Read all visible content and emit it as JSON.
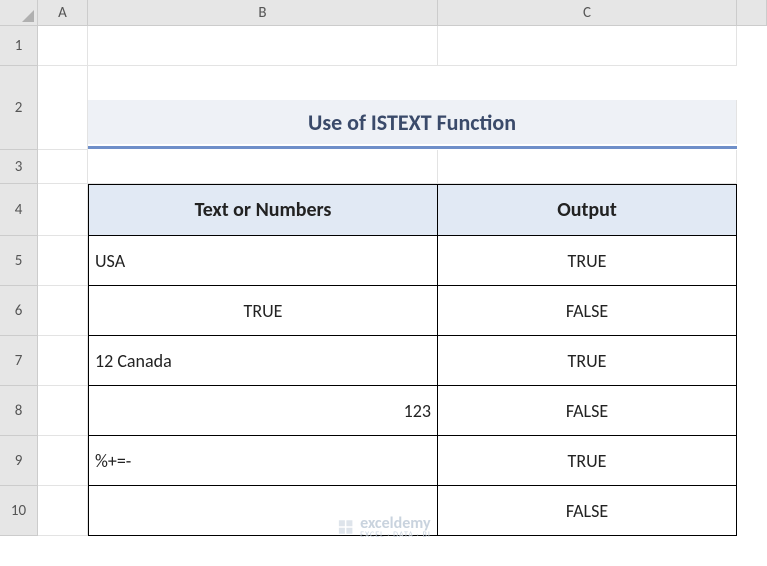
{
  "columns": {
    "A": "A",
    "B": "B",
    "C": "C"
  },
  "rows": [
    "1",
    "2",
    "3",
    "4",
    "5",
    "6",
    "7",
    "8",
    "9",
    "10"
  ],
  "title": "Use of ISTEXT Function",
  "headers": {
    "col1": "Text or Numbers",
    "col2": "Output"
  },
  "data_rows": [
    {
      "input": "USA",
      "align": "left",
      "output": "TRUE"
    },
    {
      "input": "TRUE",
      "align": "center",
      "output": "FALSE"
    },
    {
      "input": "12 Canada",
      "align": "left",
      "output": "TRUE"
    },
    {
      "input": "123",
      "align": "right",
      "output": "FALSE"
    },
    {
      "input": "%+=-",
      "align": "left",
      "output": "TRUE"
    },
    {
      "input": "",
      "align": "left",
      "output": "FALSE"
    }
  ],
  "watermark": {
    "name": "exceldemy",
    "tagline": "EXCEL · DATA · BI"
  },
  "layout": {
    "col_edges": [
      38,
      88,
      438,
      737
    ],
    "row_edges": [
      26,
      66,
      150,
      184,
      236,
      286,
      336,
      386,
      436,
      486,
      536
    ]
  },
  "chart_data": {
    "type": "table",
    "title": "Use of ISTEXT Function",
    "columns": [
      "Text or Numbers",
      "Output"
    ],
    "rows": [
      [
        "USA",
        "TRUE"
      ],
      [
        "TRUE",
        "FALSE"
      ],
      [
        "12 Canada",
        "TRUE"
      ],
      [
        123,
        "FALSE"
      ],
      [
        "%+=-",
        "TRUE"
      ],
      [
        "",
        "FALSE"
      ]
    ]
  }
}
